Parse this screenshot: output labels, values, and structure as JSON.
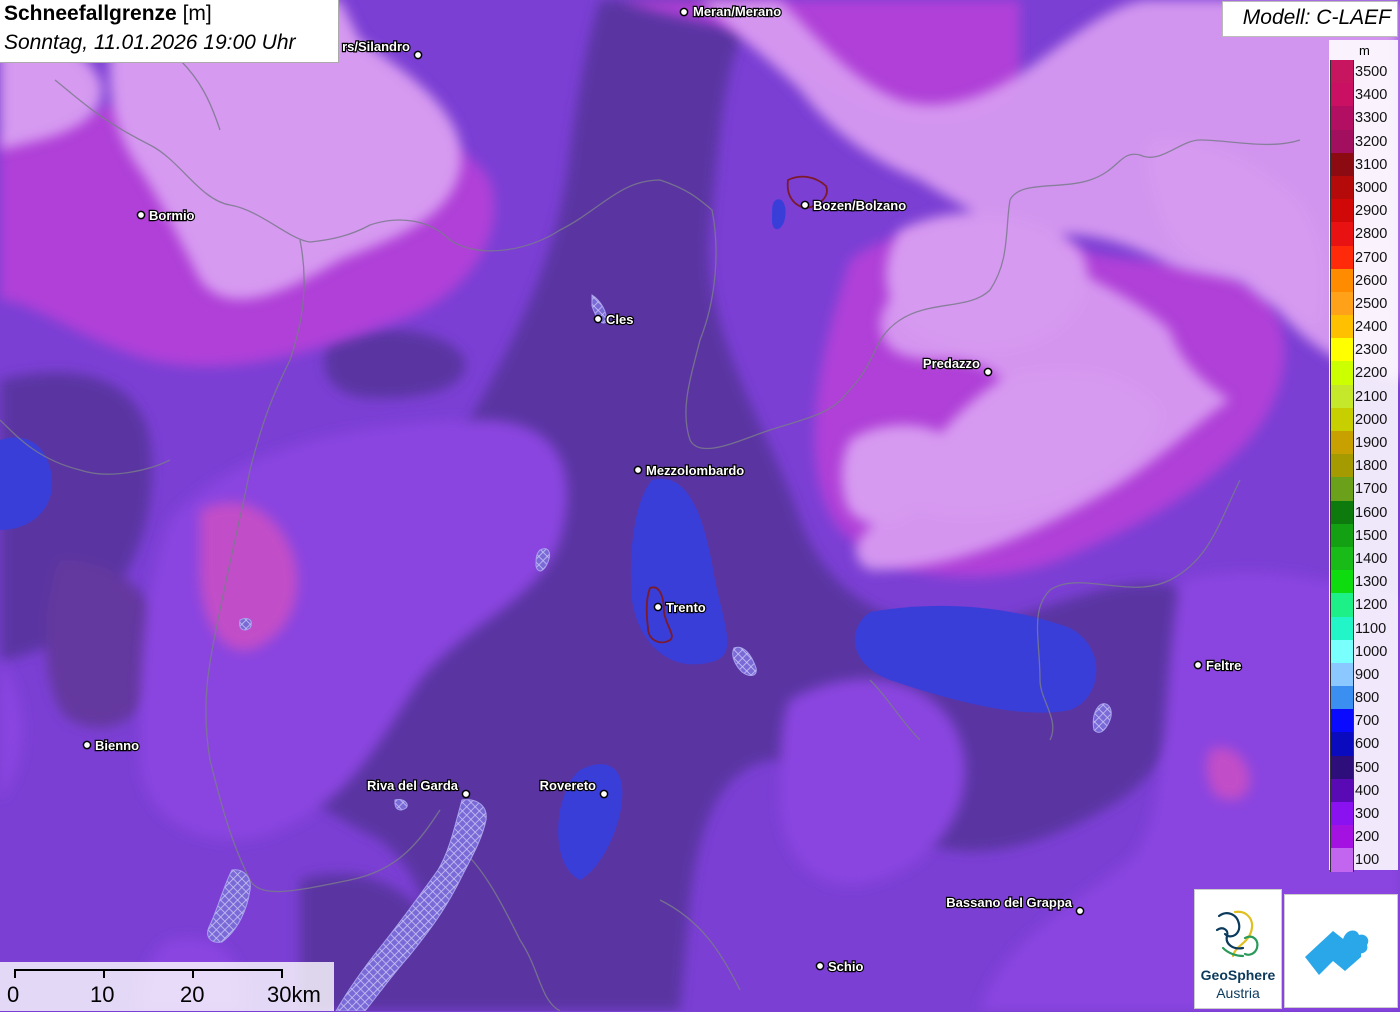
{
  "title": {
    "main": "Schneefallgrenze",
    "unit": " [m]",
    "datetime": "Sonntag, 11.01.2026 19:00 Uhr"
  },
  "model": {
    "label": "Modell: C-LAEF"
  },
  "legend": {
    "unit": "m",
    "entries": [
      {
        "value": "3500",
        "color": "#c8155f"
      },
      {
        "value": "3400",
        "color": "#c91063"
      },
      {
        "value": "3300",
        "color": "#b30f62"
      },
      {
        "value": "3200",
        "color": "#a10f5e"
      },
      {
        "value": "3100",
        "color": "#8c0a12"
      },
      {
        "value": "3000",
        "color": "#b50a0a"
      },
      {
        "value": "2900",
        "color": "#d00808"
      },
      {
        "value": "2800",
        "color": "#e81212"
      },
      {
        "value": "2700",
        "color": "#ff2a0a"
      },
      {
        "value": "2600",
        "color": "#ff8c00"
      },
      {
        "value": "2500",
        "color": "#ffa21a"
      },
      {
        "value": "2400",
        "color": "#ffc000"
      },
      {
        "value": "2300",
        "color": "#ffff00"
      },
      {
        "value": "2200",
        "color": "#ccff00"
      },
      {
        "value": "2100",
        "color": "#c6e82a"
      },
      {
        "value": "2000",
        "color": "#c8cf00"
      },
      {
        "value": "1900",
        "color": "#c8a000"
      },
      {
        "value": "1800",
        "color": "#a59a00"
      },
      {
        "value": "1700",
        "color": "#6ba01a"
      },
      {
        "value": "1600",
        "color": "#0c7a0c"
      },
      {
        "value": "1500",
        "color": "#13a013"
      },
      {
        "value": "1400",
        "color": "#18bb18"
      },
      {
        "value": "1300",
        "color": "#0fdc0f"
      },
      {
        "value": "1200",
        "color": "#1ef088"
      },
      {
        "value": "1100",
        "color": "#22f5c8"
      },
      {
        "value": "1000",
        "color": "#7affff"
      },
      {
        "value": "900",
        "color": "#8ac8ff"
      },
      {
        "value": "800",
        "color": "#3a8ff0"
      },
      {
        "value": "700",
        "color": "#0a0aff"
      },
      {
        "value": "600",
        "color": "#0a0abf"
      },
      {
        "value": "500",
        "color": "#2e0e7a"
      },
      {
        "value": "400",
        "color": "#5a0ab4"
      },
      {
        "value": "300",
        "color": "#8a12f0"
      },
      {
        "value": "200",
        "color": "#a312e0"
      },
      {
        "value": "100",
        "color": "#c266f0"
      }
    ]
  },
  "cities": [
    {
      "name": "Meran/Merano"
    },
    {
      "name": "rs/Silandro"
    },
    {
      "name": "Bormio"
    },
    {
      "name": "Bozen/Bolzano"
    },
    {
      "name": "Cles"
    },
    {
      "name": "Predazzo"
    },
    {
      "name": "Mezzolombardo"
    },
    {
      "name": "Trento"
    },
    {
      "name": "Feltre"
    },
    {
      "name": "Bienno"
    },
    {
      "name": "Riva del Garda"
    },
    {
      "name": "Rovereto"
    },
    {
      "name": "Bassano del Grappa"
    },
    {
      "name": "Schio"
    }
  ],
  "scale_bar": {
    "labels": [
      "0",
      "10",
      "20",
      "30km"
    ]
  },
  "logos": {
    "geosphere_name": "GeoSphere",
    "geosphere_sub": "Austria"
  }
}
